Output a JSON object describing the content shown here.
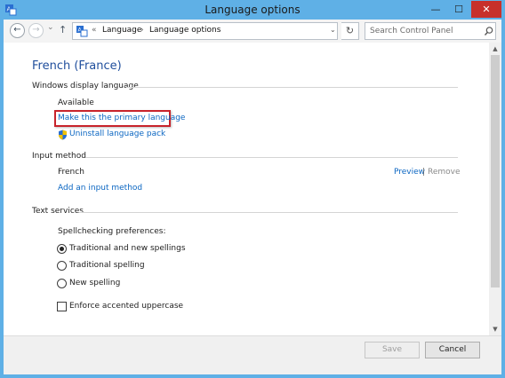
{
  "window": {
    "title": "Language options",
    "controls": {
      "minimize": "—",
      "maximize": "☐",
      "close": "✕"
    }
  },
  "nav": {
    "back_glyph": "←",
    "forward_glyph": "→",
    "recent_glyph": "⌄",
    "up_glyph": "↑",
    "overflow": "«",
    "breadcrumb": [
      "Language",
      "Language options"
    ],
    "crumb_separator": "›",
    "refresh_glyph": "↻",
    "dropdown_glyph": "⌄",
    "search_placeholder": "Search Control Panel"
  },
  "page": {
    "title": "French (France)",
    "display_language": {
      "heading": "Windows display language",
      "status": "Available",
      "primary_link": "Make this the primary language",
      "uninstall_link": "Uninstall language pack"
    },
    "input_method": {
      "heading": "Input method",
      "name": "French",
      "preview_link": "Preview",
      "separator": "|",
      "remove_link": "Remove",
      "add_link": "Add an input method"
    },
    "text_services": {
      "heading": "Text services",
      "spell_heading": "Spellchecking preferences:",
      "options": [
        {
          "label": "Traditional and new spellings",
          "selected": true
        },
        {
          "label": "Traditional spelling",
          "selected": false
        },
        {
          "label": "New spelling",
          "selected": false
        }
      ],
      "checkbox_label": "Enforce accented uppercase",
      "checkbox_checked": false
    }
  },
  "footer": {
    "save_label": "Save",
    "cancel_label": "Cancel",
    "save_enabled": false
  },
  "colors": {
    "frame": "#5fb0e6",
    "link": "#0b66c2",
    "highlight_box": "#c8232b",
    "close_button": "#c7312b"
  }
}
